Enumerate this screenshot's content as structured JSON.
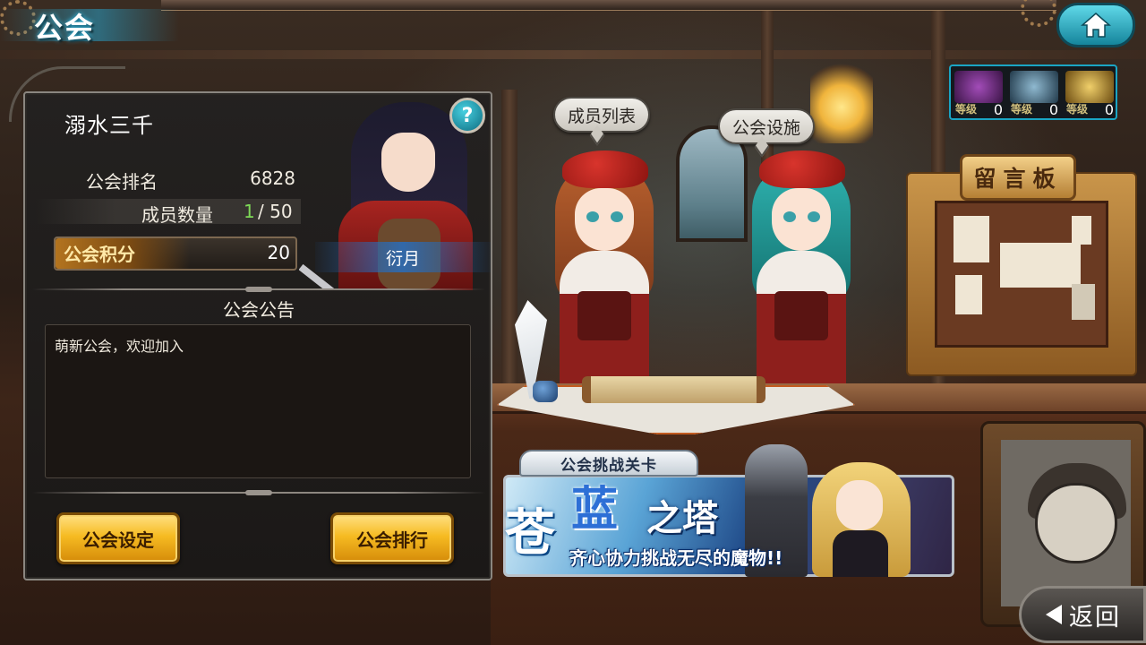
{
  "header": {
    "title": "公会",
    "home_icon": "home-icon"
  },
  "resources": [
    {
      "label": "等级",
      "count": "0",
      "icon": "purple-chest-icon",
      "color": "#6a2a7a"
    },
    {
      "label": "等级",
      "count": "0",
      "icon": "blue-orb-icon",
      "color": "#3a6a8a"
    },
    {
      "label": "等级",
      "count": "0",
      "icon": "gold-gem-icon",
      "color": "#a07a20"
    }
  ],
  "guild": {
    "name": "溺水三千",
    "help_label": "?",
    "rank_label": "公会排名",
    "rank_value": "6828",
    "members_label": "成员数量",
    "members_current": "1",
    "members_max": " / 50",
    "points_label": "公会积分",
    "points_value": "20",
    "leader_name": "衍月",
    "notice_title": "公会公告",
    "notice_text": "萌新公会，欢迎加入",
    "settings_button": "公会设定",
    "ranking_button": "公会排行"
  },
  "speech_bubbles": {
    "member_list": "成员列表",
    "facilities": "公会设施"
  },
  "message_board": {
    "title": "留言板"
  },
  "challenge_banner": {
    "tab_label": "公会挑战关卡",
    "title_1": "苍",
    "title_2": "蓝",
    "title_3": "之塔",
    "subtitle": "齐心协力挑战无尽的魔物!!"
  },
  "back_button": {
    "label": "返回",
    "icon": "arrow-left-icon"
  },
  "colors": {
    "accent_cyan": "#1aa5c4",
    "gold_button": "#f6bb22",
    "member_count_green": "#7ed957"
  }
}
